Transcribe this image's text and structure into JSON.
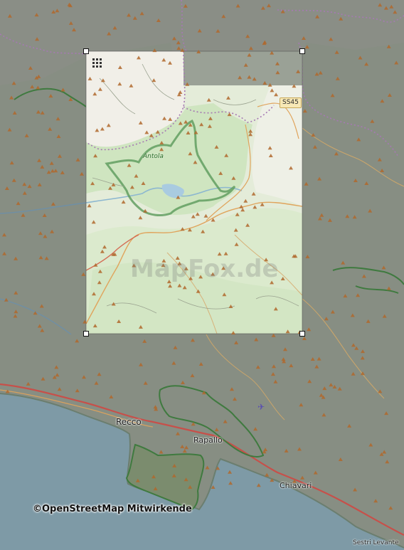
{
  "map": {
    "labels": {
      "recco": "Recco",
      "rapallo": "Rapallo",
      "chiavari": "Chiavari",
      "sestri": "Sestri Levante",
      "antola": "Antola"
    },
    "road_shield": "SS45",
    "watermark": "MapFox.de",
    "attribution": "©OpenStreetMap Mitwirkende",
    "icons": {
      "grid": "grid-icon",
      "airport": "airport-icon",
      "peak": "peak-triangle-icon"
    },
    "colors": {
      "sea": "#7e9aa6",
      "land_dimmed": "#8e9488",
      "land_highlight": "#e6efdc",
      "forest": "#cde3bd",
      "park_border": "#4f8f4f",
      "border_dashed": "#a679b3",
      "main_road": "#d4544d",
      "secondary_road": "#e8b06a",
      "peak": "#b0692d"
    }
  }
}
